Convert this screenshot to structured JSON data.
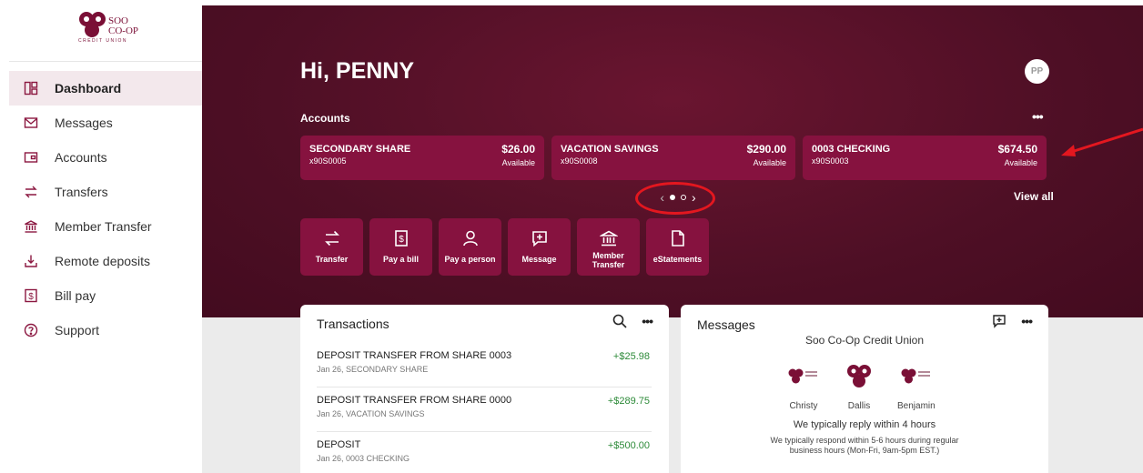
{
  "brand": {
    "logo_text_line1": "SOO",
    "logo_text_line2": "CO-OP",
    "logo_sub": "CREDIT UNION",
    "accent": "#86123f",
    "hero_bg": "#4e0f25"
  },
  "sidebar": {
    "items": [
      {
        "label": "Dashboard",
        "icon": "dashboard-icon"
      },
      {
        "label": "Messages",
        "icon": "envelope-icon"
      },
      {
        "label": "Accounts",
        "icon": "wallet-icon"
      },
      {
        "label": "Transfers",
        "icon": "transfer-arrows-icon"
      },
      {
        "label": "Member Transfer",
        "icon": "bank-icon"
      },
      {
        "label": "Remote deposits",
        "icon": "deposit-icon"
      },
      {
        "label": "Bill pay",
        "icon": "bill-icon"
      },
      {
        "label": "Support",
        "icon": "help-icon"
      }
    ]
  },
  "header": {
    "greeting": "Hi, PENNY",
    "avatar_initials": "PP"
  },
  "accounts": {
    "title": "Accounts",
    "more": "•••",
    "view_all": "View all",
    "cards": [
      {
        "name": "SECONDARY SHARE",
        "number": "x90S0005",
        "balance": "$26.00",
        "status": "Available"
      },
      {
        "name": "VACATION SAVINGS",
        "number": "x90S0008",
        "balance": "$290.00",
        "status": "Available"
      },
      {
        "name": "0003 CHECKING",
        "number": "x90S0003",
        "balance": "$674.50",
        "status": "Available"
      }
    ],
    "pager": {
      "prev": "‹",
      "next": "›",
      "pages": 2,
      "current": 1
    }
  },
  "actions": [
    {
      "label": "Transfer",
      "icon": "transfer-icon"
    },
    {
      "label": "Pay a bill",
      "icon": "bill-icon"
    },
    {
      "label": "Pay a person",
      "icon": "person-icon"
    },
    {
      "label": "Message",
      "icon": "message-plus-icon"
    },
    {
      "label": "Member Transfer",
      "icon": "bank-icon"
    },
    {
      "label": "eStatements",
      "icon": "document-icon"
    }
  ],
  "transactions": {
    "title": "Transactions",
    "more": "•••",
    "rows": [
      {
        "name": "DEPOSIT TRANSFER FROM SHARE 0003",
        "sub": "Jan 26, SECONDARY SHARE",
        "amount": "+$25.98"
      },
      {
        "name": "DEPOSIT TRANSFER FROM SHARE 0000",
        "sub": "Jan 26, VACATION SAVINGS",
        "amount": "+$289.75"
      },
      {
        "name": "DEPOSIT",
        "sub": "Jan 26, 0003 CHECKING",
        "amount": "+$500.00"
      }
    ]
  },
  "messages": {
    "title": "Messages",
    "more": "•••",
    "org_name": "Soo Co-Op Credit Union",
    "staff": [
      "Christy",
      "Dallis",
      "Benjamin"
    ],
    "reply_title": "We typically reply within 4 hours",
    "reply_sub_line1": "We typically respond within 5-6 hours during regular",
    "reply_sub_line2": "business hours (Mon-Fri, 9am-5pm EST.)"
  }
}
